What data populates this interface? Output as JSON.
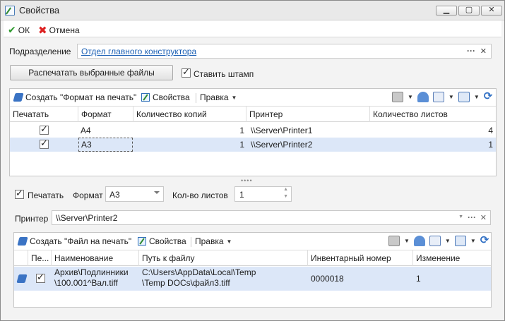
{
  "window": {
    "title": "Свойства",
    "minimize": "▁",
    "maximize": "▢",
    "close": "✕"
  },
  "toolbar": {
    "ok_label": "ОК",
    "cancel_label": "Отмена"
  },
  "division": {
    "label": "Подразделение",
    "value": "Отдел главного конструктора",
    "more": "···",
    "clear": "✕"
  },
  "print_button": "Распечатать выбранные файлы",
  "stamp": {
    "label": "Ставить штамп",
    "checked": true
  },
  "format_panel": {
    "create_label": "Создать \"Формат на печать\"",
    "props_label": "Свойства",
    "edit_label": "Правка",
    "columns": [
      "Печатать",
      "Формат",
      "Количество копий",
      "Принтер",
      "Количество листов"
    ],
    "rows": [
      {
        "print": true,
        "format": "А4",
        "copies": "1",
        "printer": "\\\\Server\\Printer1",
        "sheets": "4"
      },
      {
        "print": true,
        "format": "А3",
        "copies": "1",
        "printer": "\\\\Server\\Printer2",
        "sheets": "1"
      }
    ]
  },
  "editor": {
    "print_label": "Печатать",
    "format_label": "Формат",
    "format_value": "А3",
    "sheets_label": "Кол-во листов",
    "sheets_value": "1",
    "printer_label": "Принтер",
    "printer_value": "\\\\Server\\Printer2"
  },
  "file_panel": {
    "create_label": "Создать \"Файл на печать\"",
    "props_label": "Свойства",
    "edit_label": "Правка",
    "columns": [
      "Пе...",
      "Наименование",
      "Путь к файлу",
      "Инвентарный номер",
      "Изменение"
    ],
    "rows": [
      {
        "print": true,
        "name_line1": "Архив\\Подлинники",
        "name_line2": "\\100.001^Вал.tiff",
        "path_line1": "C:\\Users\\AppData\\Local\\Temp",
        "path_line2": "\\Temp DOCs\\файл3.tiff",
        "inventory": "0000018",
        "change": "1"
      }
    ]
  },
  "colors": {
    "selection": "#dce7f8",
    "link": "#1a5fb4",
    "ok": "#2e9a2e",
    "cancel": "#dd2222"
  }
}
